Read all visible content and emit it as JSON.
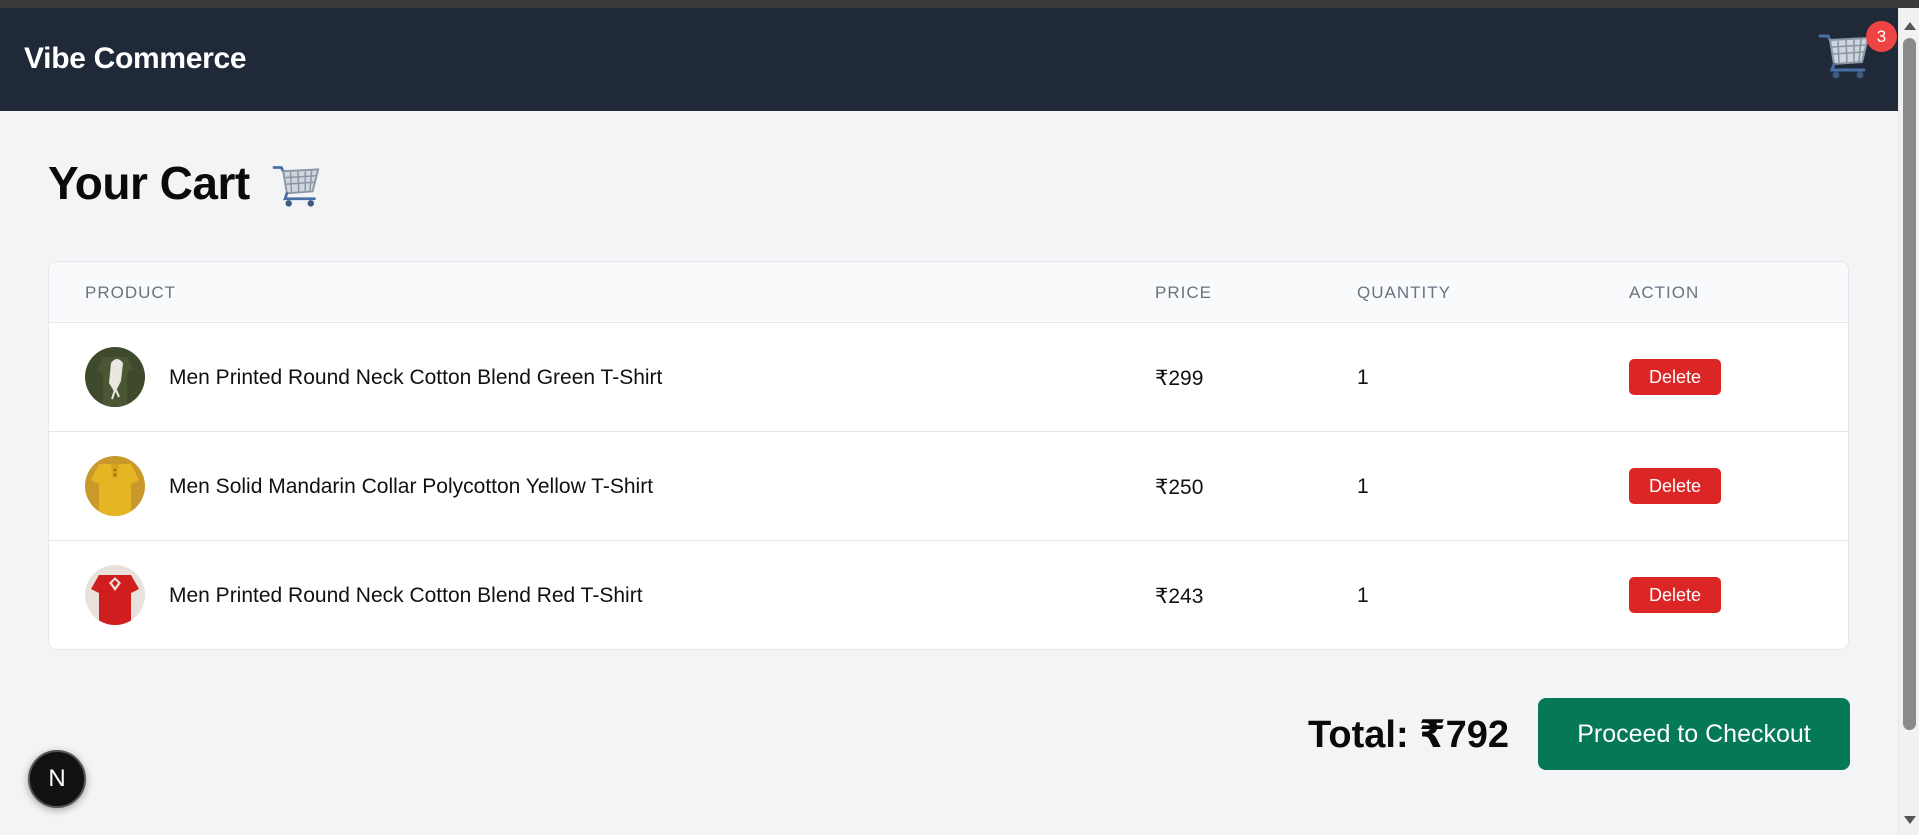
{
  "navbar": {
    "brand": "Vibe Commerce",
    "cart_icon": "shopping-cart-icon",
    "cart_count": "3"
  },
  "page": {
    "title": "Your Cart",
    "title_icon": "shopping-cart-icon"
  },
  "table": {
    "headers": [
      "PRODUCT",
      "PRICE",
      "QUANTITY",
      "ACTION"
    ],
    "rows": [
      {
        "name": "Men Printed Round Neck Cotton Blend Green T-Shirt",
        "price": "₹299",
        "quantity": "1",
        "action": "Delete",
        "thumb_color": "#3f4a2c"
      },
      {
        "name": "Men Solid Mandarin Collar Polycotton Yellow T-Shirt",
        "price": "₹250",
        "quantity": "1",
        "action": "Delete",
        "thumb_color": "#e6b523"
      },
      {
        "name": "Men Printed Round Neck Cotton Blend Red T-Shirt",
        "price": "₹243",
        "quantity": "1",
        "action": "Delete",
        "thumb_color": "#d01e1e"
      }
    ]
  },
  "summary": {
    "total": "Total: ₹792",
    "checkout_label": "Proceed to Checkout"
  },
  "dev_badge": {
    "label": "N",
    "icon": "nextjs-icon"
  },
  "colors": {
    "navbar": "#1f2937",
    "badge": "#ef4444",
    "delete": "#dc2626",
    "checkout": "#047857",
    "page_bg": "#f3f4f6"
  }
}
